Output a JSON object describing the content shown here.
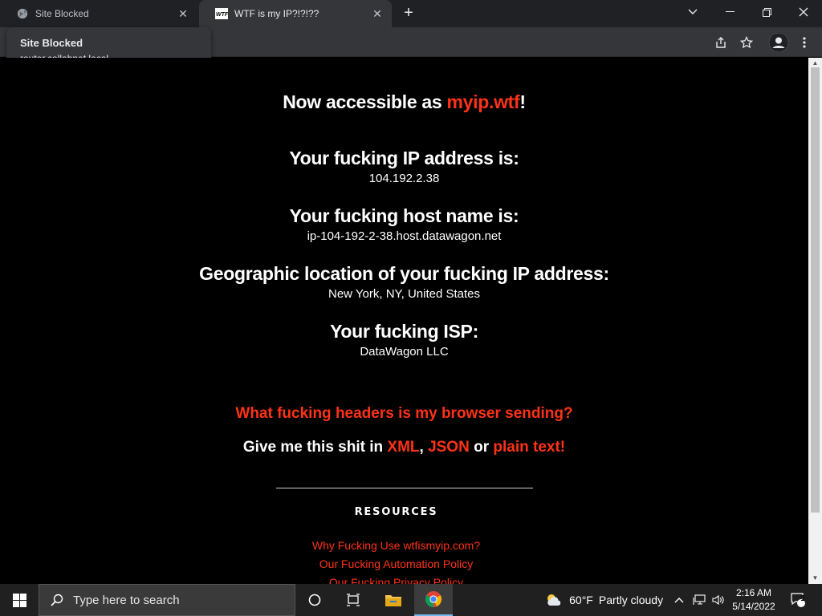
{
  "browser": {
    "tabs": [
      {
        "title": "Site Blocked",
        "icon": "globe-icon",
        "active": false
      },
      {
        "title": "WTF is my IP?!?!??",
        "icon": "wtf-favicon",
        "active": true
      }
    ],
    "hover_card": {
      "title": "Site Blocked",
      "url": "router.collabnet.local"
    }
  },
  "page": {
    "banner_prefix": "Now accessible as ",
    "banner_link": "myip.wtf",
    "banner_suffix": "!",
    "ip_heading": "Your fucking IP address is:",
    "ip_value": "104.192.2.38",
    "host_heading": "Your fucking host name is:",
    "host_value": "ip-104-192-2-38.host.datawagon.net",
    "geo_heading": "Geographic location of your fucking IP address:",
    "geo_value": "New York, NY, United States",
    "isp_heading": "Your fucking ISP:",
    "isp_value": "DataWagon LLC",
    "headers_link": "What fucking headers is my browser sending?",
    "formats_prefix": "Give me this shit in ",
    "format_xml": "XML",
    "format_sep1": ", ",
    "format_json": "JSON",
    "format_sep2": " or ",
    "format_plain": "plain text!",
    "resources_title": "RESOURCES",
    "resources_links": [
      "Why Fucking Use wtfismyip.com?",
      "Our Fucking Automation Policy",
      "Our Fucking Privacy Policy"
    ],
    "accent_color": "#ff3217"
  },
  "taskbar": {
    "search_placeholder": "Type here to search",
    "weather_temp": "60°F",
    "weather_desc": "Partly cloudy",
    "time": "2:16 AM",
    "date": "5/14/2022",
    "notification_count": "1"
  }
}
